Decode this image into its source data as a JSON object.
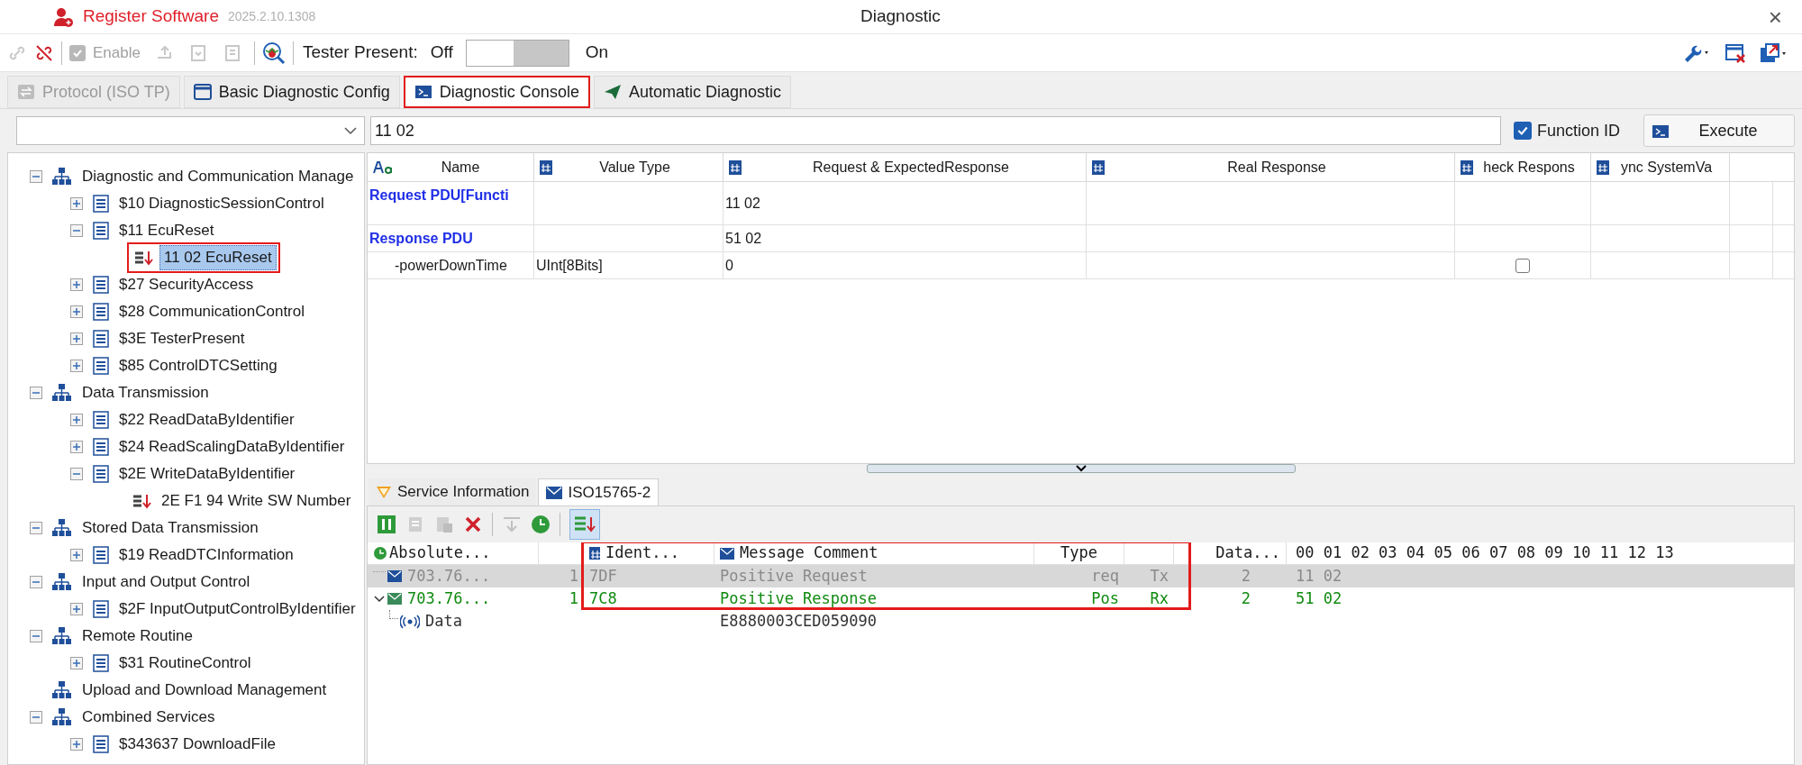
{
  "window": {
    "app_name": "Register Software",
    "version": "2025.2.10.1308",
    "title": "Diagnostic",
    "close": "×"
  },
  "toolbar": {
    "enable": {
      "label": "Enable",
      "checked": true,
      "disabled": true
    },
    "tester_present": {
      "label": "Tester Present:",
      "off_label": "Off",
      "on_label": "On",
      "on": false
    }
  },
  "tabs": [
    {
      "label": "Protocol (ISO TP)",
      "selected": false,
      "disabled": true,
      "kind": "protocol"
    },
    {
      "label": "Basic Diagnostic Config",
      "selected": false,
      "disabled": false,
      "kind": "config"
    },
    {
      "label": "Diagnostic Console",
      "selected": true,
      "disabled": false,
      "kind": "console"
    },
    {
      "label": "Automatic Diagnostic",
      "selected": false,
      "disabled": false,
      "kind": "auto"
    }
  ],
  "request_bar": {
    "input": "11 02",
    "function_id": {
      "label": "Function ID",
      "checked": true
    },
    "execute": "Execute"
  },
  "tree": [
    {
      "label": "Diagnostic and Communication Manage",
      "kind": "group",
      "expanded": true,
      "selected": false,
      "children": [
        {
          "label": "$10 DiagnosticSessionControl",
          "kind": "service",
          "expanded": false,
          "selected": false
        },
        {
          "label": "$11 EcuReset",
          "kind": "service",
          "expanded": true,
          "selected": false,
          "children": [
            {
              "label": "11 02 EcuReset",
              "kind": "request",
              "selected": true
            }
          ]
        },
        {
          "label": "$27 SecurityAccess",
          "kind": "service",
          "expanded": false,
          "selected": false
        },
        {
          "label": "$28 CommunicationControl",
          "kind": "service",
          "expanded": false,
          "selected": false
        },
        {
          "label": "$3E TesterPresent",
          "kind": "service",
          "expanded": false,
          "selected": false
        },
        {
          "label": "$85 ControlDTCSetting",
          "kind": "service",
          "expanded": false,
          "selected": false
        }
      ]
    },
    {
      "label": "Data Transmission",
      "kind": "group",
      "expanded": true,
      "selected": false,
      "children": [
        {
          "label": "$22 ReadDataByIdentifier",
          "kind": "service",
          "expanded": false,
          "selected": false
        },
        {
          "label": "$24 ReadScalingDataByIdentifier",
          "kind": "service",
          "expanded": false,
          "selected": false
        },
        {
          "label": "$2E WriteDataByIdentifier",
          "kind": "service",
          "expanded": true,
          "selected": false,
          "children": [
            {
              "label": "2E F1 94 Write SW Number",
              "kind": "request",
              "selected": false
            }
          ]
        }
      ]
    },
    {
      "label": "Stored Data Transmission",
      "kind": "group",
      "expanded": true,
      "selected": false,
      "children": [
        {
          "label": "$19 ReadDTCInformation",
          "kind": "service",
          "expanded": false,
          "selected": false
        }
      ]
    },
    {
      "label": "Input and Output Control",
      "kind": "group",
      "expanded": true,
      "selected": false,
      "children": [
        {
          "label": "$2F InputOutputControlByIdentifier",
          "kind": "service",
          "expanded": false,
          "selected": false
        }
      ]
    },
    {
      "label": "Remote Routine",
      "kind": "group",
      "expanded": true,
      "selected": false,
      "children": [
        {
          "label": "$31 RoutineControl",
          "kind": "service",
          "expanded": false,
          "selected": false
        }
      ]
    },
    {
      "label": "Upload and Download Management",
      "kind": "group",
      "selected": false
    },
    {
      "label": "Combined Services",
      "kind": "group",
      "expanded": true,
      "selected": false,
      "children": [
        {
          "label": "$343637 DownloadFile",
          "kind": "service",
          "expanded": false,
          "selected": false
        }
      ]
    }
  ],
  "grid": {
    "columns": [
      {
        "label": "Name",
        "kind": "text"
      },
      {
        "label": "Value Type",
        "kind": "number"
      },
      {
        "label": "Request & ExpectedResponse",
        "kind": "number"
      },
      {
        "label": "Real Response",
        "kind": "number"
      },
      {
        "label": "heck Respons",
        "kind": "number"
      },
      {
        "label": "ync SystemVa",
        "kind": "number"
      }
    ],
    "rows": [
      {
        "kind": "pdu",
        "name": "Request PDU[Functi",
        "request": "11 02"
      },
      {
        "kind": "pdu",
        "name": "Response PDU",
        "request": "51 02"
      },
      {
        "kind": "param",
        "name": "-powerDownTime",
        "value_type": "UInt[8Bits]",
        "request": "0",
        "check": {
          "checked": false
        }
      }
    ]
  },
  "bottom_tabs": [
    {
      "label": "Service Information",
      "selected": false,
      "kind": "info"
    },
    {
      "label": "ISO15765-2",
      "selected": true,
      "kind": "frame"
    }
  ],
  "log": {
    "columns": [
      "Absolute...",
      "Ident...",
      "Message Comment",
      "Type",
      "Data...",
      "00 01 02 03 04 05 06 07 08 09 10 11 12 13"
    ],
    "rows": [
      {
        "time": "703.76...",
        "count": "1",
        "ident": "7DF",
        "comment": "Positive Request",
        "type": "req",
        "dir": "Tx",
        "dlc": "2",
        "bytes": "11 02",
        "color": "#8a8a8a",
        "selected": true
      },
      {
        "time": "703.76...",
        "count": "1",
        "ident": "7C8",
        "comment": "Positive Response",
        "type": "Pos",
        "dir": "Rx",
        "dlc": "2",
        "bytes": "51 02",
        "color": "#108a10",
        "selected": false,
        "expanded": true,
        "children": [
          {
            "label": "Data",
            "value": "E8880003CED059090"
          }
        ]
      }
    ]
  }
}
